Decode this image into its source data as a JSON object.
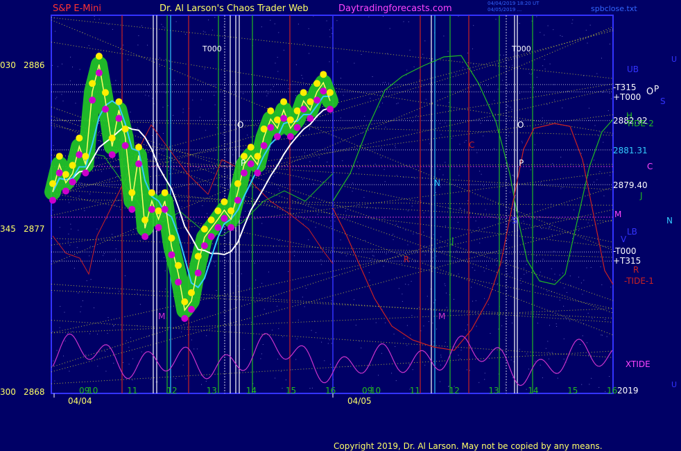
{
  "header": {
    "instrument": "S&P E-Mini",
    "site_title": "Dr. Al Larson's Chaos Trader Web",
    "site_url": "Daytradingforecasts.com",
    "timestamp_1": "04/04/2019 18:20 UT",
    "timestamp_2": "04/05/2019 ...",
    "file_name": "spbclose.txt"
  },
  "price_axis": {
    "labels": [
      {
        "left": "030",
        "right": "2886"
      },
      {
        "left": "345",
        "right": "2877"
      },
      {
        "left": "300",
        "right": "2868"
      }
    ]
  },
  "date_axis": {
    "day1_label": "04/04",
    "day2_label": "04/05",
    "day1_hours": [
      "09",
      "10",
      "11",
      "12",
      "13",
      "14",
      "15",
      "16"
    ],
    "day2_hours": [
      "09",
      "10",
      "11",
      "12",
      "13",
      "14",
      "15",
      "16"
    ]
  },
  "right_labels": {
    "ub": "UB",
    "t315_top": "-T315",
    "t000_top": "+T000",
    "op": "O",
    "op_p": "P",
    "s": "S",
    "h": "H",
    "price1": "2882.92",
    "tide2": "-TIDE-2",
    "price2": "2881.31",
    "c": "C",
    "price3": "2879.40",
    "j": "J",
    "m": "M",
    "n": "N",
    "lb": "LB",
    "v": "V",
    "t000_bot": "-T000",
    "t315_bot": "+T315",
    "r": "R",
    "tide1": "-TIDE-1",
    "xtide": "XTIDE",
    "year": "2019",
    "u_top": "U",
    "u_bot": "U"
  },
  "chart_labels": {
    "t000_a": "T000",
    "t000_b": "T000",
    "o_a": "O",
    "p_a": "P",
    "o_b": "O",
    "p_b": "P",
    "m_a": "M",
    "m_b": "M",
    "n_a": "N",
    "r_a": "R",
    "j_a": "J",
    "s_a": "S",
    "c_a": "C"
  },
  "footer": {
    "copyright": "Copyright 2019, Dr. Al Larson. May not be copied by any means."
  },
  "colors": {
    "background": "#000066",
    "frame": "#3333ff",
    "price_line": "#ffff66",
    "ema_cyan": "#33ccff",
    "avg_white": "#ffffff",
    "tide_red": "#cc2222",
    "tide_green": "#22bb22",
    "xtide_magenta": "#cc33cc",
    "band_green": "#22cc22",
    "dot_yellow": "#ffee00",
    "dot_magenta": "#cc00cc"
  },
  "chart_data": {
    "type": "line",
    "title": "S&P E-Mini",
    "ylim": [
      2868,
      2888
    ],
    "y_ticks": [
      2868,
      2877,
      2886
    ],
    "series": [
      {
        "name": "S&P E-Mini",
        "x": [
          9.0,
          9.17,
          9.33,
          9.5,
          9.67,
          9.83,
          10.0,
          10.17,
          10.33,
          10.5,
          10.67,
          10.83,
          11.0,
          11.17,
          11.33,
          11.5,
          11.67,
          11.83,
          12.0,
          12.17,
          12.33,
          12.5,
          12.67,
          12.83,
          13.0,
          13.17,
          13.33,
          13.5,
          13.67,
          13.83,
          14.0,
          14.17,
          14.33,
          14.5,
          14.67,
          14.83,
          15.0,
          15.17,
          15.33,
          15.5,
          15.67,
          15.83,
          16.0
        ],
        "values": [
          2879.0,
          2880.5,
          2879.5,
          2880.0,
          2881.5,
          2880.5,
          2884.5,
          2886.0,
          2884.0,
          2881.5,
          2883.5,
          2882.0,
          2878.5,
          2881.0,
          2877.0,
          2878.5,
          2877.5,
          2878.5,
          2876.0,
          2874.5,
          2872.5,
          2873.0,
          2875.0,
          2876.5,
          2877.0,
          2877.5,
          2878.0,
          2877.5,
          2879.0,
          2880.5,
          2881.0,
          2880.5,
          2882.0,
          2883.0,
          2882.5,
          2883.5,
          2882.5,
          2883.0,
          2884.0,
          2883.5,
          2884.5,
          2885.0,
          2884.0
        ]
      }
    ],
    "horizontal_levels": [
      {
        "name": "-T315",
        "value": 2884.9
      },
      {
        "name": "+T000",
        "value": 2884.5
      },
      {
        "name": "2882.92",
        "value": 2882.92
      },
      {
        "name": "2881.31",
        "value": 2881.31
      },
      {
        "name": "2879.40",
        "value": 2879.4
      },
      {
        "name": "-T000",
        "value": 2875.7
      },
      {
        "name": "+T315",
        "value": 2875.2
      }
    ]
  }
}
